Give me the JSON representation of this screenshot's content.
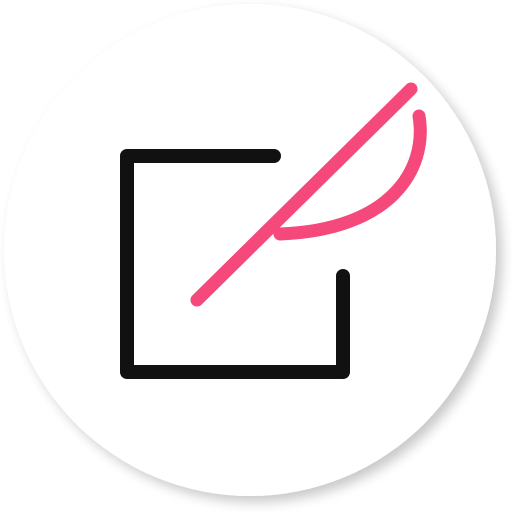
{
  "icon": {
    "name": "note-edit-app-icon",
    "colors": {
      "background": "#ffffff",
      "shadow": "#000000",
      "frame": "#111111",
      "pen": "#f4497a"
    }
  }
}
